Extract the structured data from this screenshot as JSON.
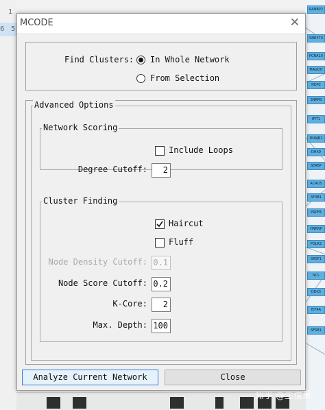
{
  "background": {
    "left_numbers": [
      "1",
      "6",
      "5"
    ],
    "network_nodes": [
      "RANBP2",
      "SNRP70",
      "PCNA10",
      "MAGOH",
      "NOP2",
      "SNRPB",
      "IFIT1",
      "DNAJB1",
      "DHX9",
      "SERBP",
      "ACADS",
      "SF3B1",
      "PRPF8",
      "HNRNP",
      "POLR2",
      "SRSF1",
      "NCL",
      "DDX5",
      "EIF4A",
      "SFSB1"
    ],
    "watermark": "知乎 @生信果"
  },
  "window": {
    "title": "MCODE",
    "find_clusters": {
      "label": "Find Clusters:",
      "options": [
        "In Whole Network",
        "From Selection"
      ],
      "selected": "In Whole Network"
    },
    "advanced_options": {
      "title": "Advanced Options",
      "network_scoring": {
        "title": "Network Scoring",
        "include_loops": {
          "label": "Include Loops",
          "checked": false
        },
        "degree_cutoff": {
          "label": "Degree Cutoff:",
          "value": "2"
        }
      },
      "cluster_finding": {
        "title": "Cluster Finding",
        "haircut": {
          "label": "Haircut",
          "checked": true
        },
        "fluff": {
          "label": "Fluff",
          "checked": false
        },
        "node_density_cutoff": {
          "label": "Node Density Cutoff:",
          "value": "0.1",
          "enabled": false
        },
        "node_score_cutoff": {
          "label": "Node Score Cutoff:",
          "value": "0.2"
        },
        "k_core": {
          "label": "K-Core:",
          "value": "2"
        },
        "max_depth": {
          "label": "Max. Depth:",
          "value": "100"
        }
      }
    },
    "buttons": {
      "analyze": "Analyze Current Network",
      "close": "Close"
    }
  }
}
